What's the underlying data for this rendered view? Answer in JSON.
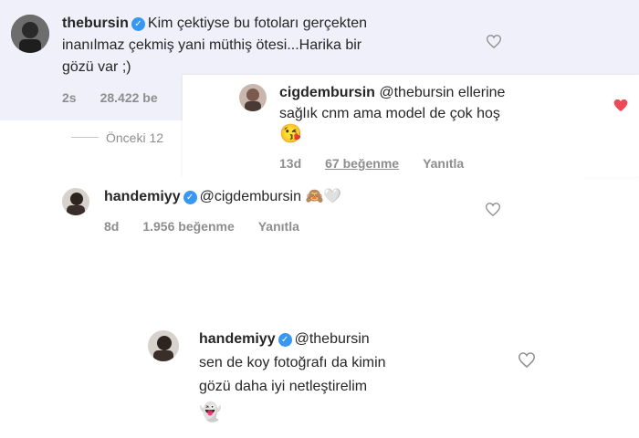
{
  "comments": [
    {
      "username": "thebursin",
      "text_lines": [
        "Kim çektiyse bu fotoları gerçekten",
        "inanılmaz çekmiş yani müthiş ötesi...Harika bir",
        "gözü var ;)"
      ],
      "time": "2s",
      "likes": "28.422 be"
    },
    {
      "username": "cigdembursin",
      "mention": "@thebursin",
      "text_tail": " ellerine",
      "text_line2": "sağlık cnm ama model de çok hoş",
      "emoji": "😘",
      "time": "13d",
      "likes": "67 beğenme",
      "reply": "Yanıtla"
    },
    {
      "username": "handemiyy",
      "mention": "@cigdembursin",
      "emoji": "🙈🤍",
      "time": "8d",
      "likes": "1.956 beğenme",
      "reply": "Yanıtla"
    },
    {
      "username": "handemiyy",
      "mention": "@thebursin",
      "text_lines": [
        "sen de koy fotoğrafı da kimin",
        "gözü daha iyi netleştirelim"
      ],
      "emoji": "👻"
    }
  ],
  "previous_replies": "Önceki 12",
  "colors": {
    "liked_heart": "#ed4956",
    "verified": "#3897f0"
  }
}
